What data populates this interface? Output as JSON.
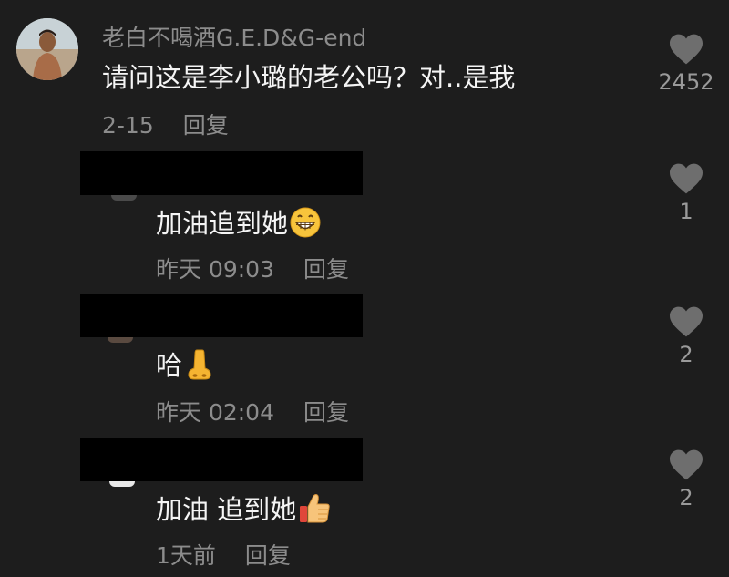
{
  "comment": {
    "author": "老白不喝酒G.E.D&G-end",
    "text": "请问这是李小璐的老公吗？对..是我",
    "date": "2-15",
    "reply_label": "回复",
    "likes": "2452"
  },
  "replies": [
    {
      "text": "加油追到她",
      "emoji": "grinning-face-emoji",
      "time": "昨天 09:03",
      "reply_label": "回复",
      "likes": "1"
    },
    {
      "text": "哈",
      "emoji": "nose-emoji",
      "time": "昨天 02:04",
      "reply_label": "回复",
      "likes": "2"
    },
    {
      "text": "加油 追到她",
      "emoji": "thumbs-up-emoji",
      "time": "1天前",
      "reply_label": "回复",
      "likes": "2"
    }
  ],
  "colors": {
    "background": "#1d1d1d",
    "primary_text": "#f5f5f5",
    "secondary_text": "#8c8c8c",
    "heart_icon": "#6e6e6e",
    "redaction": "#000000"
  }
}
